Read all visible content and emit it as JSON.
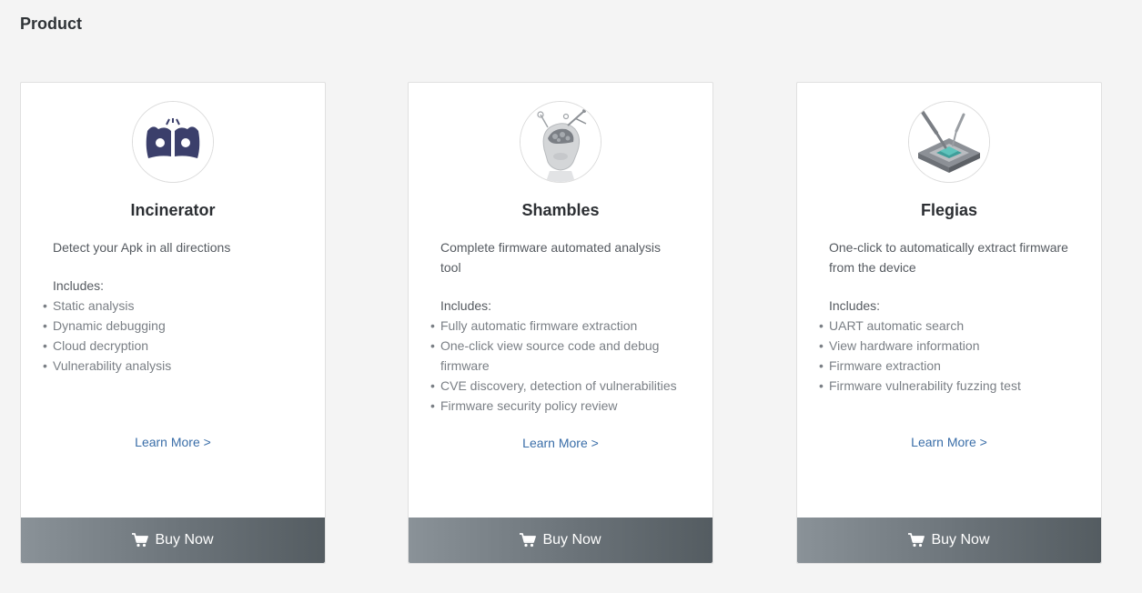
{
  "page": {
    "title": "Product"
  },
  "colors": {
    "link": "#3a6ea8",
    "buy_bar_start": "#8a9298",
    "buy_bar_end": "#545c61"
  },
  "products": [
    {
      "icon": "android-bug-icon",
      "name": "Incinerator",
      "description": "Detect your Apk in all directions",
      "includes_label": "Includes:",
      "features": [
        "Static analysis",
        "Dynamic debugging",
        "Cloud decryption",
        "Vulnerability analysis"
      ],
      "learn_more": "Learn More >",
      "buy_label": "Buy Now"
    },
    {
      "icon": "robot-head-icon",
      "name": "Shambles",
      "description": "Complete firmware automated analysis tool",
      "includes_label": "Includes:",
      "features": [
        "Fully automatic firmware extraction",
        "One-click view source code and debug firmware",
        "CVE discovery, detection of vulnerabilities",
        "Firmware security policy review"
      ],
      "learn_more": "Learn More >",
      "buy_label": "Buy Now"
    },
    {
      "icon": "chip-probe-icon",
      "name": "Flegias",
      "description": "One-click to automatically extract firmware from the device",
      "includes_label": "Includes:",
      "features": [
        "UART automatic search",
        "View hardware information",
        "Firmware extraction",
        "Firmware vulnerability fuzzing test"
      ],
      "learn_more": "Learn More >",
      "buy_label": "Buy Now"
    }
  ]
}
